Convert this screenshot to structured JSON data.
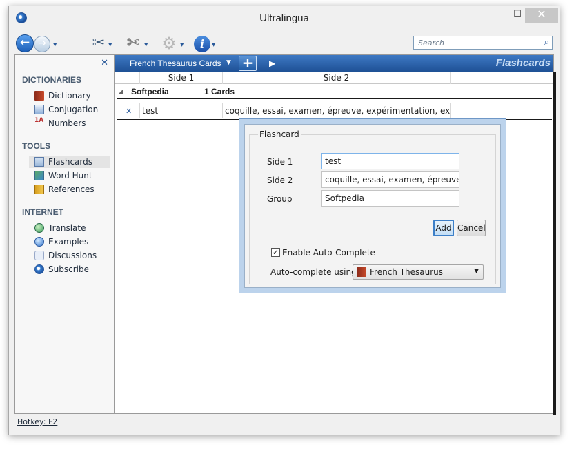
{
  "window": {
    "title": "Ultralingua",
    "min_glyph": "–",
    "max_glyph": "☐",
    "close_glyph": "✕"
  },
  "toolbar": {
    "back_glyph": "←",
    "forward_glyph": "→",
    "tools_glyph": "✂",
    "scissors_glyph": "✄",
    "gear_glyph": "⚙",
    "info_glyph": "i",
    "search_placeholder": "Search",
    "search_value": ""
  },
  "sidebar": {
    "close_glyph": "✕",
    "sections": [
      {
        "title": "DICTIONARIES",
        "items": [
          {
            "label": "Dictionary",
            "icon": "dictionary-icon"
          },
          {
            "label": "Conjugation",
            "icon": "conjugation-icon"
          },
          {
            "label": "Numbers",
            "icon": "numbers-icon"
          }
        ]
      },
      {
        "title": "TOOLS",
        "items": [
          {
            "label": "Flashcards",
            "icon": "flashcards-icon",
            "active": true
          },
          {
            "label": "Word Hunt",
            "icon": "word-hunt-icon"
          },
          {
            "label": "References",
            "icon": "references-icon"
          }
        ]
      },
      {
        "title": "INTERNET",
        "items": [
          {
            "label": "Translate",
            "icon": "translate-icon"
          },
          {
            "label": "Examples",
            "icon": "examples-icon"
          },
          {
            "label": "Discussions",
            "icon": "discussions-icon"
          },
          {
            "label": "Subscribe",
            "icon": "subscribe-icon"
          }
        ]
      }
    ],
    "numbers_glyph": "1 A\n↳",
    "hotkey": "Hotkey: F2"
  },
  "flashcards": {
    "set_name": "French Thesaurus Cards",
    "set_caret": "▼",
    "add_glyph": "+",
    "play_glyph": "▶",
    "header_title": "Flashcards",
    "columns": [
      "Side 1",
      "Side 2"
    ],
    "group": {
      "caret": "◢",
      "name": "Softpedia",
      "count": "1 Cards"
    },
    "rows": [
      {
        "delete_glyph": "✕",
        "side1": "test",
        "side2": "coquille, essai, examen, épreuve, expérimentation, expérience"
      }
    ]
  },
  "dialog": {
    "legend": "Flashcard",
    "side1_label": "Side 1",
    "side1_value": "test",
    "side2_label": "Side 2",
    "side2_value": "coquille, essai, examen, épreuve, expérimentation, expérience",
    "group_label": "Group",
    "group_value": "Softpedia",
    "add_label": "Add",
    "cancel_label": "Cancel",
    "autocomplete_checked": true,
    "check_glyph": "✓",
    "autocomplete_label": "Enable Auto-Complete",
    "autocomplete_using_label": "Auto-complete using:",
    "autocomplete_source": "French Thesaurus",
    "dropdown_glyph": "▼"
  },
  "colors": {
    "header_blue": "#2d63ab",
    "accent": "#3c7fc8",
    "dialog_frame": "#bcd3ec"
  }
}
